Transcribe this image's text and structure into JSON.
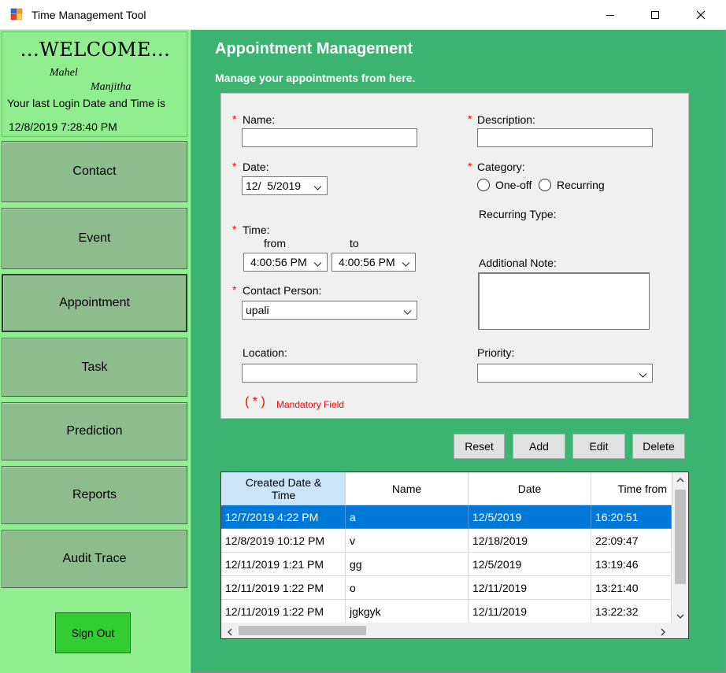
{
  "window": {
    "title": "Time Management Tool"
  },
  "sidebar": {
    "welcome": "...WELCOME...",
    "user_first": "Mahel",
    "user_last": "Manjitha",
    "last_login_label": "Your last Login Date and Time is",
    "last_login_value": "12/8/2019 7:28:40 PM",
    "nav": [
      {
        "label": "Contact"
      },
      {
        "label": "Event"
      },
      {
        "label": "Appointment"
      },
      {
        "label": "Task"
      },
      {
        "label": "Prediction"
      },
      {
        "label": "Reports"
      },
      {
        "label": "Audit Trace"
      }
    ],
    "signout_label": "Sign Out"
  },
  "main": {
    "title": "Appointment Management",
    "subtitle": "Manage your appointments from here."
  },
  "form": {
    "required_marker": "*",
    "name_label": "Name:",
    "name_value": "",
    "description_label": "Description:",
    "description_value": "",
    "date_label": "Date:",
    "date_value": "12/  5/2019",
    "category_label": "Category:",
    "category_options": [
      "One-off",
      "Recurring"
    ],
    "recurring_type_label": "Recurring Type:",
    "time_label": "Time:",
    "time_from_label": "from",
    "time_to_label": "to",
    "time_from_value": "4:00:56 PM",
    "time_to_value": "4:00:56 PM",
    "contact_label": "Contact Person:",
    "contact_value": "upali",
    "additional_note_label": "Additional Note:",
    "location_label": "Location:",
    "location_value": "",
    "priority_label": "Priority:",
    "priority_value": "",
    "mandatory_marker": "( * )",
    "mandatory_text": "Mandatory Field"
  },
  "actions": {
    "reset": "Reset",
    "add": "Add",
    "edit": "Edit",
    "delete": "Delete"
  },
  "grid": {
    "columns": [
      "Created Date & Time",
      "Name",
      "Date",
      "Time from"
    ],
    "rows": [
      [
        "12/7/2019 4:22 PM",
        "a",
        "12/5/2019",
        "16:20:51"
      ],
      [
        "12/8/2019 10:12 PM",
        "v",
        "12/18/2019",
        "22:09:47"
      ],
      [
        "12/11/2019 1:21 PM",
        "gg",
        "12/5/2019",
        "13:19:46"
      ],
      [
        "12/11/2019 1:22 PM",
        "o",
        "12/11/2019",
        "13:21:40"
      ],
      [
        "12/11/2019 1:22 PM",
        "jgkgyk",
        "12/11/2019",
        "13:22:32"
      ]
    ],
    "selected_row": 0
  },
  "icons": {
    "app": "app-icon",
    "minimize": "minimize-icon",
    "maximize": "maximize-icon",
    "close": "close-icon",
    "dropdown": "chevron-down-icon"
  },
  "colors": {
    "main_bg": "#3cb371",
    "sidebar_bg": "#90ee90",
    "nav_button": "#8fbc8f",
    "signout_button": "#32cd32",
    "selection": "#0078d7",
    "required": "#ff0000"
  }
}
